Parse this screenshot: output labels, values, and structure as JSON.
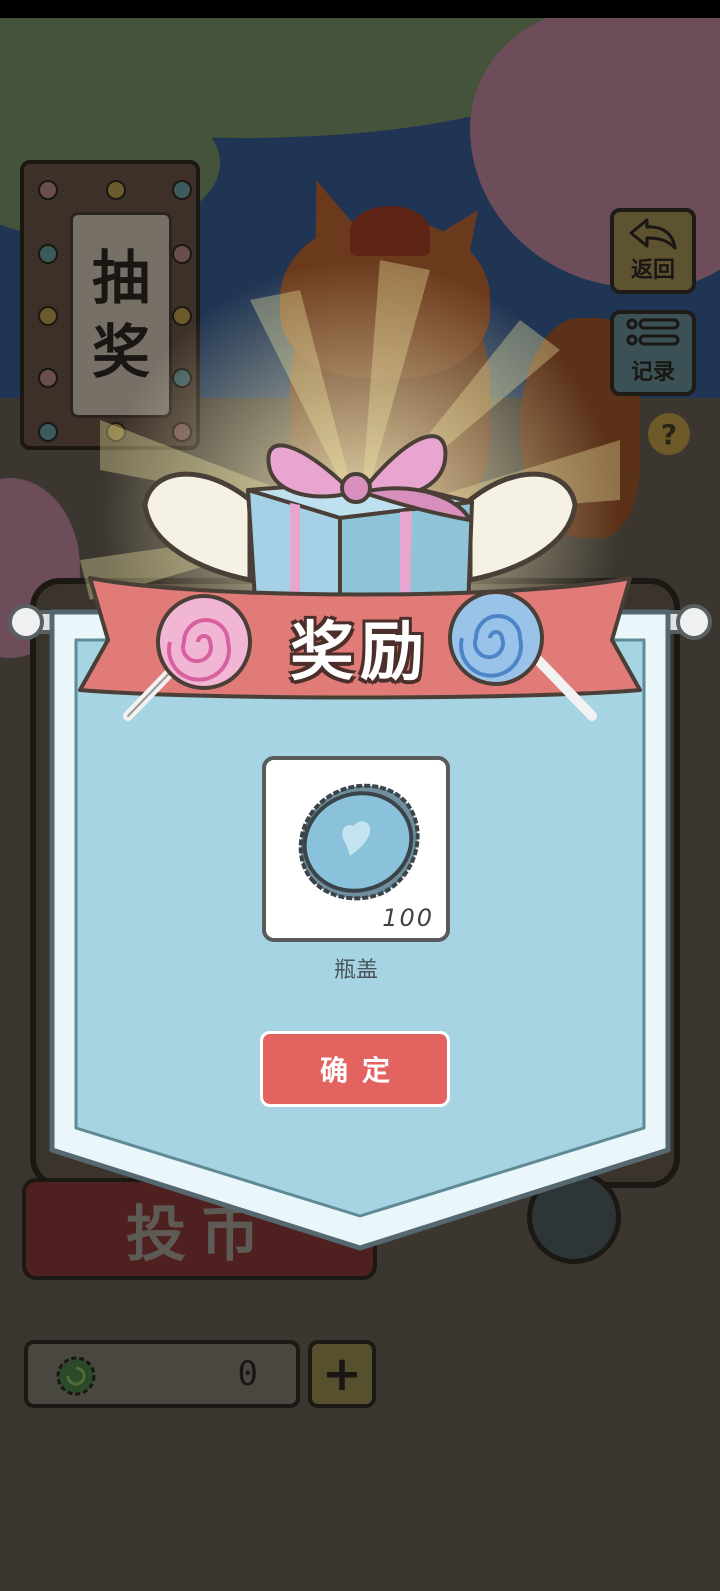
{
  "scene": {
    "sign_chars": [
      "抽",
      "奖"
    ],
    "back_label": "返回",
    "record_label": "记录",
    "help_symbol": "?",
    "coin_button_label": "投币",
    "currency_value": "0",
    "plus_symbol": "+"
  },
  "reward": {
    "title": "奖励",
    "item_name": "瓶盖",
    "item_quantity": "100",
    "confirm_label": "确定"
  },
  "colors": {
    "banner": "#a6d4e2",
    "banner_border": "#eaf7fa",
    "ribbon": "#e07b78",
    "gift_box": "#a4d1e5",
    "gift_bow": "#e7a5cf",
    "confirm": "#e2635f",
    "bottle_cap": "#8bc2db"
  }
}
